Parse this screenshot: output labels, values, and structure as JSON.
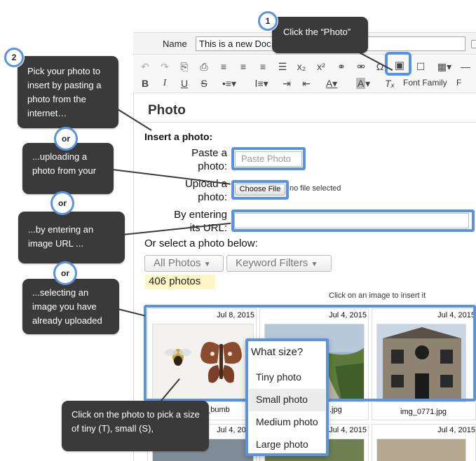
{
  "editor": {
    "name_label": "Name",
    "name_value": "This is a new Doc",
    "font_family": "Font Family",
    "font_size_initial": "F"
  },
  "toolbar": {
    "row1": [
      "undo-icon",
      "redo-icon",
      "paste-icon",
      "paste-text-icon",
      "align-left-icon",
      "align-center-icon",
      "align-right-icon",
      "justify-icon",
      "subscript-icon",
      "superscript-icon",
      "link-icon",
      "unlink-icon",
      "omega-icon",
      "photo-icon",
      "bookmark-icon",
      "table-icon"
    ],
    "row2": [
      "bold-icon",
      "italic-icon",
      "underline-icon",
      "strike-icon",
      "bullet-list-icon",
      "numbered-list-icon",
      "indent-icon",
      "text-color-icon",
      "bg-color-icon",
      "clear-format-icon"
    ]
  },
  "photo_panel": {
    "title": "Photo",
    "insert_label": "Insert a photo:",
    "paste_label_1": "Paste a",
    "paste_label_2": "photo:",
    "paste_placeholder": "Paste Photo",
    "upload_label_1": "Upload a",
    "upload_label_2": "photo:",
    "choose_file": "Choose File",
    "no_file": "no file selected",
    "url_label_1": "By entering",
    "url_label_2": "its URL:",
    "select_below": "Or select a photo below:",
    "all_photos": "All Photos",
    "keyword_filters": "Keyword Filters",
    "count": "406 photos",
    "click_hint": "Click on an image to insert it"
  },
  "photos": [
    {
      "date": "Jul 8, 2015",
      "file": "rk_bumb"
    },
    {
      "date": "Jul 4, 2015",
      "file": ".jpg"
    },
    {
      "date": "Jul 4, 2015",
      "file": "img_0771.jpg"
    },
    {
      "date": "Jul 4, 2015",
      "file": ""
    },
    {
      "date": "Jul 4, 2015",
      "file": ""
    },
    {
      "date": "Jul 4, 2015",
      "file": ""
    }
  ],
  "size_popup": {
    "title": "What size?",
    "options": [
      "Tiny photo",
      "Small photo",
      "Medium photo",
      "Large photo"
    ],
    "hovered": "Small photo"
  },
  "callouts": {
    "step1_number": "1",
    "step1_text": "Click the “Photo”",
    "step2_number": "2",
    "step2_text": "Pick your photo to insert by pasting a photo from the internet…",
    "upload_text": "...uploading a photo from your",
    "url_text": "...by entering an image URL ...",
    "select_text": "...selecting an image you have already uploaded",
    "size_text": "Click on the photo to pick a size of tiny (T), small (S),",
    "or_label": "or"
  },
  "colors": {
    "highlight": "#5a93e0",
    "callout_bg": "#3a3a3a",
    "count_badge_bg": "#fdf7c6"
  }
}
